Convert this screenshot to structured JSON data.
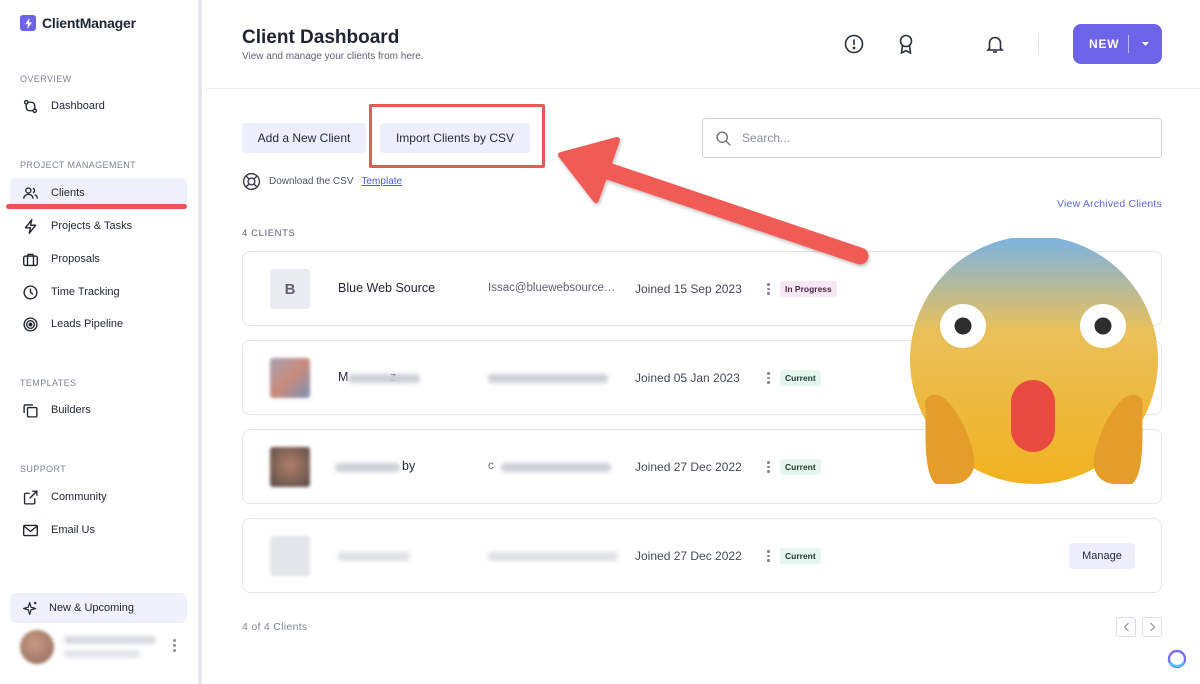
{
  "app": {
    "name": "ClientManager"
  },
  "sidebar": {
    "sections": [
      {
        "label": "OVERVIEW"
      },
      {
        "label": "PROJECT MANAGEMENT"
      },
      {
        "label": "TEMPLATES"
      },
      {
        "label": "SUPPORT"
      }
    ],
    "items": [
      {
        "label": "Dashboard",
        "icon": "dashboard-icon"
      },
      {
        "label": "Clients",
        "icon": "users-icon",
        "active": true
      },
      {
        "label": "Projects & Tasks",
        "icon": "lightning-icon"
      },
      {
        "label": "Proposals",
        "icon": "briefcase-icon"
      },
      {
        "label": "Time Tracking",
        "icon": "clock-icon"
      },
      {
        "label": "Leads Pipeline",
        "icon": "target-icon"
      },
      {
        "label": "Builders",
        "icon": "copy-icon"
      },
      {
        "label": "Community",
        "icon": "external-link-icon"
      },
      {
        "label": "Email Us",
        "icon": "mail-icon"
      }
    ],
    "upcoming": {
      "label": "New & Upcoming",
      "icon": "sparkle-icon"
    }
  },
  "header": {
    "title": "Client Dashboard",
    "subtitle": "View and manage your clients from here.",
    "new_button": "NEW"
  },
  "actions": {
    "add_client": "Add a New Client",
    "import_csv": "Import Clients by CSV",
    "download_prefix": "Download the CSV",
    "template_link": "Template",
    "archived_link": "View Archived Clients"
  },
  "search": {
    "placeholder": "Search..."
  },
  "clients": {
    "count_label": "4 CLIENTS",
    "rows": [
      {
        "avatar_initial": "B",
        "name": "Blue Web Source",
        "email": "Issac@bluewebsource.com",
        "joined": "Joined 15 Sep 2023",
        "status": "In Progress"
      },
      {
        "avatar_initial": "",
        "name": "M            z",
        "email": "",
        "joined": "Joined 05 Jan 2023",
        "status": "Current"
      },
      {
        "avatar_initial": "",
        "name": "by",
        "email": "c",
        "joined": "Joined 27 Dec 2022",
        "status": "Current"
      },
      {
        "avatar_initial": "",
        "name": "",
        "email": "",
        "joined": "Joined 27 Dec 2022",
        "status": "Current",
        "action": "Manage"
      }
    ]
  },
  "pagination": {
    "label": "4 of 4 Clients"
  },
  "colors": {
    "accent": "#6c63e8",
    "highlight": "#e55a55",
    "badge_progress_bg": "#f7e7f4",
    "badge_current_bg": "#e4f6ee"
  }
}
